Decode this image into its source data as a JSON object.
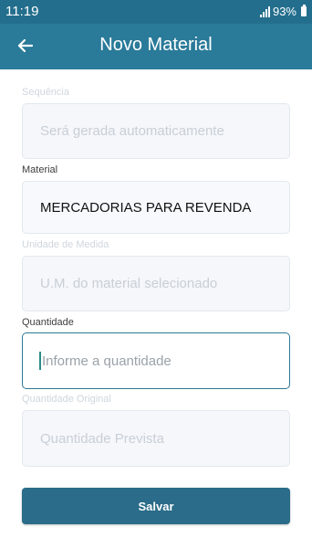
{
  "status": {
    "time": "11:19",
    "battery": "93%"
  },
  "appbar": {
    "title": "Novo Material",
    "back_icon": "arrow-left-icon"
  },
  "form": {
    "sequencia": {
      "label": "Sequência",
      "placeholder": "Será gerada automaticamente"
    },
    "material": {
      "label": "Material",
      "value": "MERCADORIAS PARA REVENDA"
    },
    "unidade": {
      "label": "Unidade de Medida",
      "placeholder": "U.M. do material selecionado"
    },
    "quantidade": {
      "label": "Quantidade",
      "placeholder": "Informe a quantidade"
    },
    "quantidade_original": {
      "label": "Quantidade Original",
      "placeholder": "Quantidade Prevista"
    }
  },
  "actions": {
    "save_label": "Salvar"
  },
  "colors": {
    "appbar": "#2a7a99",
    "statusbar": "#236e8d",
    "button": "#2a6c89",
    "focus_border": "#2c7a92"
  }
}
